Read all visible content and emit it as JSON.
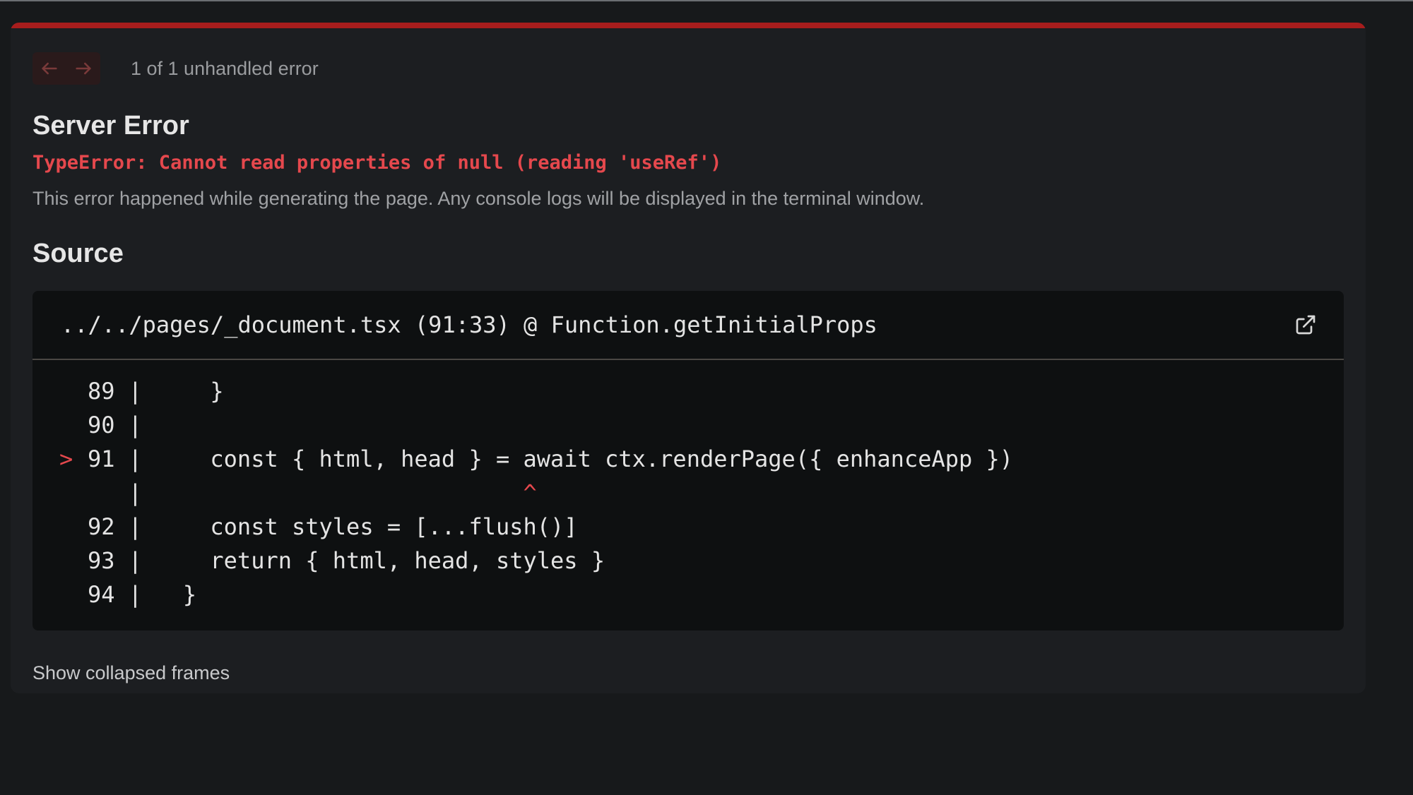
{
  "overlay": {
    "nav": {
      "prev_icon": "arrow-left-icon",
      "next_icon": "arrow-right-icon",
      "count_text": "1 of 1 unhandled error"
    },
    "title": "Server Error",
    "error_message": "TypeError: Cannot read properties of null (reading 'useRef')",
    "description": "This error happened while generating the page. Any console logs will be displayed in the terminal window.",
    "source_heading": "Source",
    "source": {
      "file_path": "../../pages/_document.tsx (91:33) @ Function.getInitialProps",
      "open_icon": "external-link-icon",
      "lines": [
        {
          "marker": "",
          "text": "89 |     }"
        },
        {
          "marker": "",
          "text": "90 |"
        },
        {
          "marker": ">",
          "text": "91 |     const { html, head } = await ctx.renderPage({ enhanceApp })"
        },
        {
          "marker": "",
          "text": "   |",
          "caret": "^"
        },
        {
          "marker": "",
          "text": "92 |     const styles = [...flush()]"
        },
        {
          "marker": "",
          "text": "93 |     return { html, head, styles }"
        },
        {
          "marker": "",
          "text": "94 |   }"
        }
      ]
    },
    "show_collapsed_label": "Show collapsed frames"
  },
  "colors": {
    "accent": "#a71d1d",
    "error_text": "#e5484d",
    "background": "#17191b",
    "dialog": "#1c1e21",
    "code_background": "#0e1011"
  }
}
